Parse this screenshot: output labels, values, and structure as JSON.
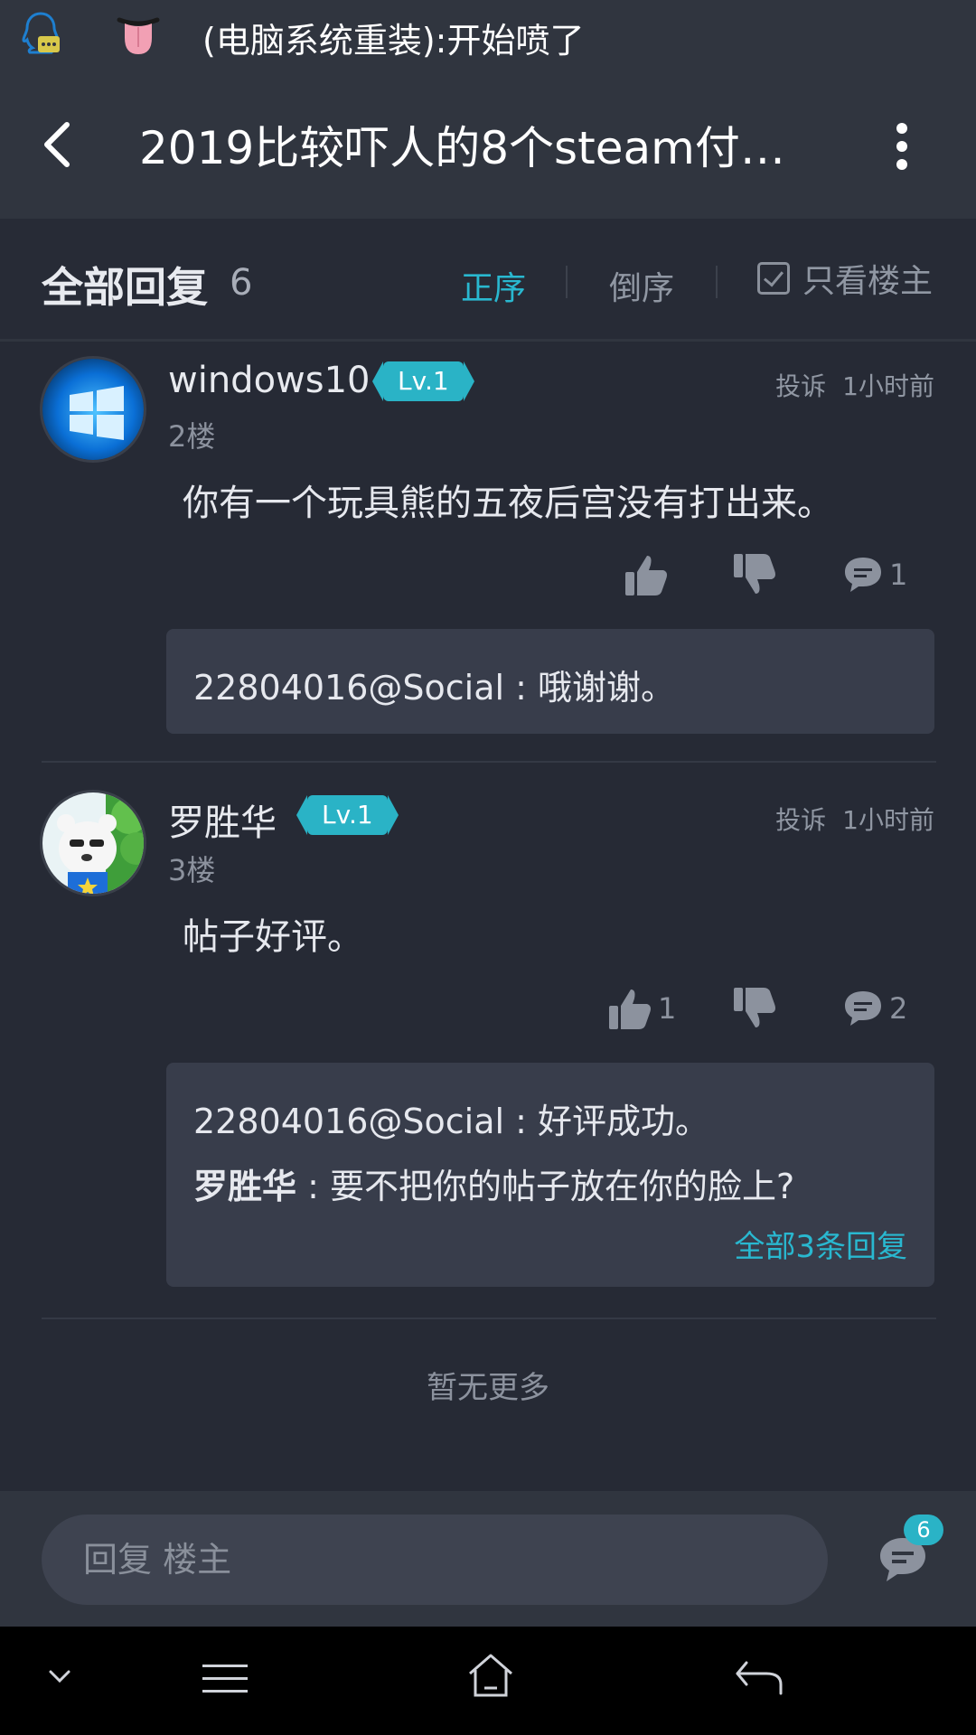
{
  "status_bar": {
    "notification_text": "(电脑系统重装):开始喷了"
  },
  "top_bar": {
    "title": "2019比较吓人的8个steam付…"
  },
  "reply_header": {
    "title": "全部回复",
    "count": "6",
    "sort_asc": "正序",
    "sort_desc": "倒序",
    "only_op": "只看楼主"
  },
  "comments": [
    {
      "username": "windows10",
      "level": "Lv.1",
      "floor": "2楼",
      "report": "投诉",
      "time": "1小时前",
      "content": "你有一个玩具熊的五夜后宫没有打出来。",
      "likes": "",
      "reply_count": "1",
      "sub_replies": [
        {
          "user": "22804016@Social",
          "separator": " : ",
          "text": "哦谢谢。"
        }
      ]
    },
    {
      "username": "罗胜华",
      "level": "Lv.1",
      "floor": "3楼",
      "report": "投诉",
      "time": "1小时前",
      "content": "帖子好评。",
      "likes": "1",
      "reply_count": "2",
      "sub_replies": [
        {
          "user": "22804016@Social",
          "separator": " : ",
          "text": "好评成功。"
        },
        {
          "user": "罗胜华",
          "separator": " : ",
          "text": "要不把你的帖子放在你的脸上?"
        }
      ],
      "view_all": "全部3条回复"
    }
  ],
  "footer": {
    "no_more": "暂无更多"
  },
  "reply_bar": {
    "placeholder": "回复  楼主",
    "comment_badge": "6"
  },
  "colors": {
    "accent": "#2ab3c6",
    "background": "#262a35",
    "panel": "#30353f",
    "sub_box": "#383d4b"
  },
  "icons": {
    "notification_app": "qq-icon",
    "notification_emoji": "tongue-emoji-icon",
    "back": "chevron-left-icon",
    "more": "more-vertical-icon",
    "like": "thumbs-up-icon",
    "dislike": "thumbs-down-icon",
    "reply": "comment-bubble-icon",
    "nav_down": "chevron-down-icon",
    "nav_menu": "menu-icon",
    "nav_home": "home-icon",
    "nav_back": "back-arrow-icon"
  }
}
